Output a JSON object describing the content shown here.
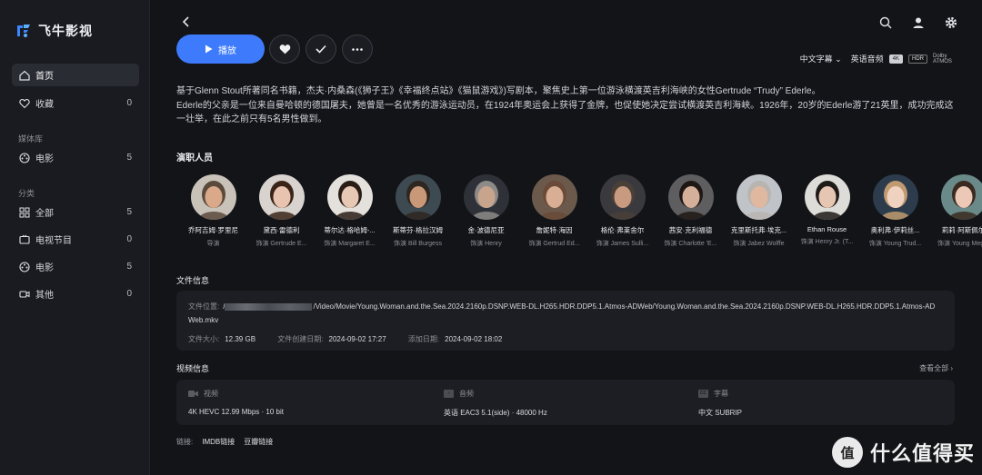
{
  "app": {
    "name": "飞牛影视"
  },
  "sidebar": {
    "items": [
      {
        "label": "首页",
        "count": "",
        "icon": "home-icon",
        "active": true
      },
      {
        "label": "收藏",
        "count": "0",
        "icon": "heart-icon"
      }
    ],
    "library_label": "媒体库",
    "library_items": [
      {
        "label": "电影",
        "count": "5",
        "icon": "film-reel-icon"
      }
    ],
    "category_label": "分类",
    "category_items": [
      {
        "label": "全部",
        "count": "5",
        "icon": "grid-icon"
      },
      {
        "label": "电视节目",
        "count": "0",
        "icon": "tv-icon"
      },
      {
        "label": "电影",
        "count": "5",
        "icon": "film-reel-icon"
      },
      {
        "label": "其他",
        "count": "0",
        "icon": "video-icon"
      }
    ]
  },
  "actions": {
    "play_label": "播放"
  },
  "meta": {
    "subtitle": "中文字幕",
    "audio": "英语音频",
    "badge_4k": "4K",
    "badge_hdr": "HDR",
    "dolby": "Dolby ATMOS"
  },
  "description": {
    "line1": "基于Glenn Stout所著同名书籍，杰夫·内桑森(《狮子王》《幸福终点站》《猫鼠游戏》)写剧本，聚焦史上第一位游泳横渡英吉利海峡的女性Gertrude “Trudy” Ederle。",
    "line2": "Ederle的父亲是一位来自曼哈顿的德国屠夫，她曾是一名优秀的游泳运动员，在1924年奥运会上获得了金牌，也促使她决定尝试横渡英吉利海峡。1926年，20岁的Ederle游了21英里，成功完成这一壮举，在此之前只有5名男性做到。"
  },
  "cast_title": "演职人员",
  "cast": [
    {
      "name": "乔阿吉姆·罗里尼",
      "role": "导演",
      "skin": "#d9a98a",
      "hair": "#5a4a3c",
      "bg": "#c9c2b8"
    },
    {
      "name": "黛西·雷德利",
      "role": "饰演 Gertrude E...",
      "skin": "#e8c3b0",
      "hair": "#3a2418",
      "bg": "#d9d3cf"
    },
    {
      "name": "蒂尔达·格哈姆-...",
      "role": "饰演 Margaret E...",
      "skin": "#e7c8b5",
      "hair": "#2a1d16",
      "bg": "#e4e0dc"
    },
    {
      "name": "斯蒂芬·格拉汉姆",
      "role": "饰演 Bill Burgess",
      "skin": "#c89878",
      "hair": "#2e2620",
      "bg": "#3e4a52"
    },
    {
      "name": "金·波德尼亚",
      "role": "饰演 Henry",
      "skin": "#c9a48c",
      "hair": "#8d8a88",
      "bg": "#2e3238"
    },
    {
      "name": "詹妮特·海因",
      "role": "饰演 Gertrud Ed...",
      "skin": "#d8ae94",
      "hair": "#6a4a38",
      "bg": "#6b5a4c"
    },
    {
      "name": "格伦·弗莱舍尔",
      "role": "饰演 James Sulli...",
      "skin": "#c89a80",
      "hair": "#4a4038",
      "bg": "#3a3a3e"
    },
    {
      "name": "茜安·克利福德",
      "role": "饰演 Charlotte 'E...",
      "skin": "#d4b09a",
      "hair": "#1e1714",
      "bg": "#5e5e60"
    },
    {
      "name": "克里斯托弗·埃克...",
      "role": "饰演 Jabez Wolffe",
      "skin": "#e0b8a0",
      "hair": "#b8b4b0",
      "bg": "#c0c4c8"
    },
    {
      "name": "Ethan Rouse",
      "role": "饰演 Henry Jr. (T...",
      "skin": "#e6c6b2",
      "hair": "#1e1a18",
      "bg": "#dedcd8"
    },
    {
      "name": "奥利弗·伊莉丝...",
      "role": "饰演 Young Trud...",
      "skin": "#f0d2c0",
      "hair": "#c09a70",
      "bg": "#2c3c4c"
    },
    {
      "name": "莉莉·阿斯佩尔",
      "role": "饰演 Young Meg...",
      "skin": "#ecc8b6",
      "hair": "#3a2a20",
      "bg": "#6a8a8a"
    }
  ],
  "file_info": {
    "title": "文件信息",
    "path_label": "文件位置:",
    "path_prefix": "/",
    "path_main": "/Video/Movie/Young.Woman.and.the.Sea.2024.2160p.DSNP.WEB-DL.H265.HDR.DDP5.1.Atmos-ADWeb/Young.Woman.and.the.Sea.2024.2160p.DSNP.WEB-DL.H265.HDR.DDP5.1.Atmos-AD",
    "path_tail": "Web.mkv",
    "size_label": "文件大小:",
    "size": "12.39 GB",
    "created_label": "文件创建日期:",
    "created": "2024-09-02 17:27",
    "added_label": "添加日期:",
    "added": "2024-09-02 18:02"
  },
  "video_info": {
    "title": "视频信息",
    "view_all": "查看全部",
    "video_label": "视频",
    "video_value": "4K HEVC 12.99 Mbps · 10 bit",
    "audio_label": "音频",
    "audio_value": "英语 EAC3 5.1(side) · 48000 Hz",
    "subtitle_label": "字幕",
    "subtitle_value": "中文 SUBRIP"
  },
  "links": {
    "label": "链接:",
    "imdb": "IMDB链接",
    "douban": "豆瓣链接"
  },
  "watermark": {
    "logo": "值",
    "text": "什么值得买"
  }
}
